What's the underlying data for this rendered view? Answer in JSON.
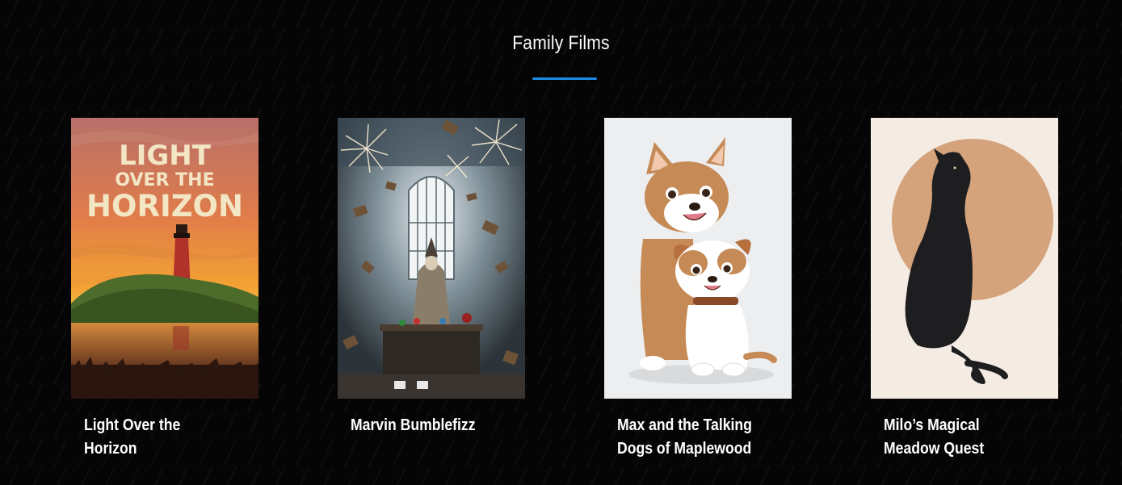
{
  "section": {
    "title": "Family Films",
    "accent_color": "#1e88e5"
  },
  "films": [
    {
      "title": "Light Over the Horizon",
      "poster": {
        "icon": "lighthouse-sunset-poster",
        "text_line1": "LIGHT",
        "text_line2": "OVER THE",
        "text_line3": "HORIZON"
      }
    },
    {
      "title": "Marvin Bumblefizz",
      "poster": {
        "icon": "wizard-library-fireworks-poster"
      }
    },
    {
      "title": "Max and the Talking Dogs of Maplewood",
      "poster": {
        "icon": "cartoon-dogs-poster"
      }
    },
    {
      "title": "Milo’s Magical Meadow Quest",
      "poster": {
        "icon": "black-cat-silhouette-poster"
      }
    }
  ]
}
